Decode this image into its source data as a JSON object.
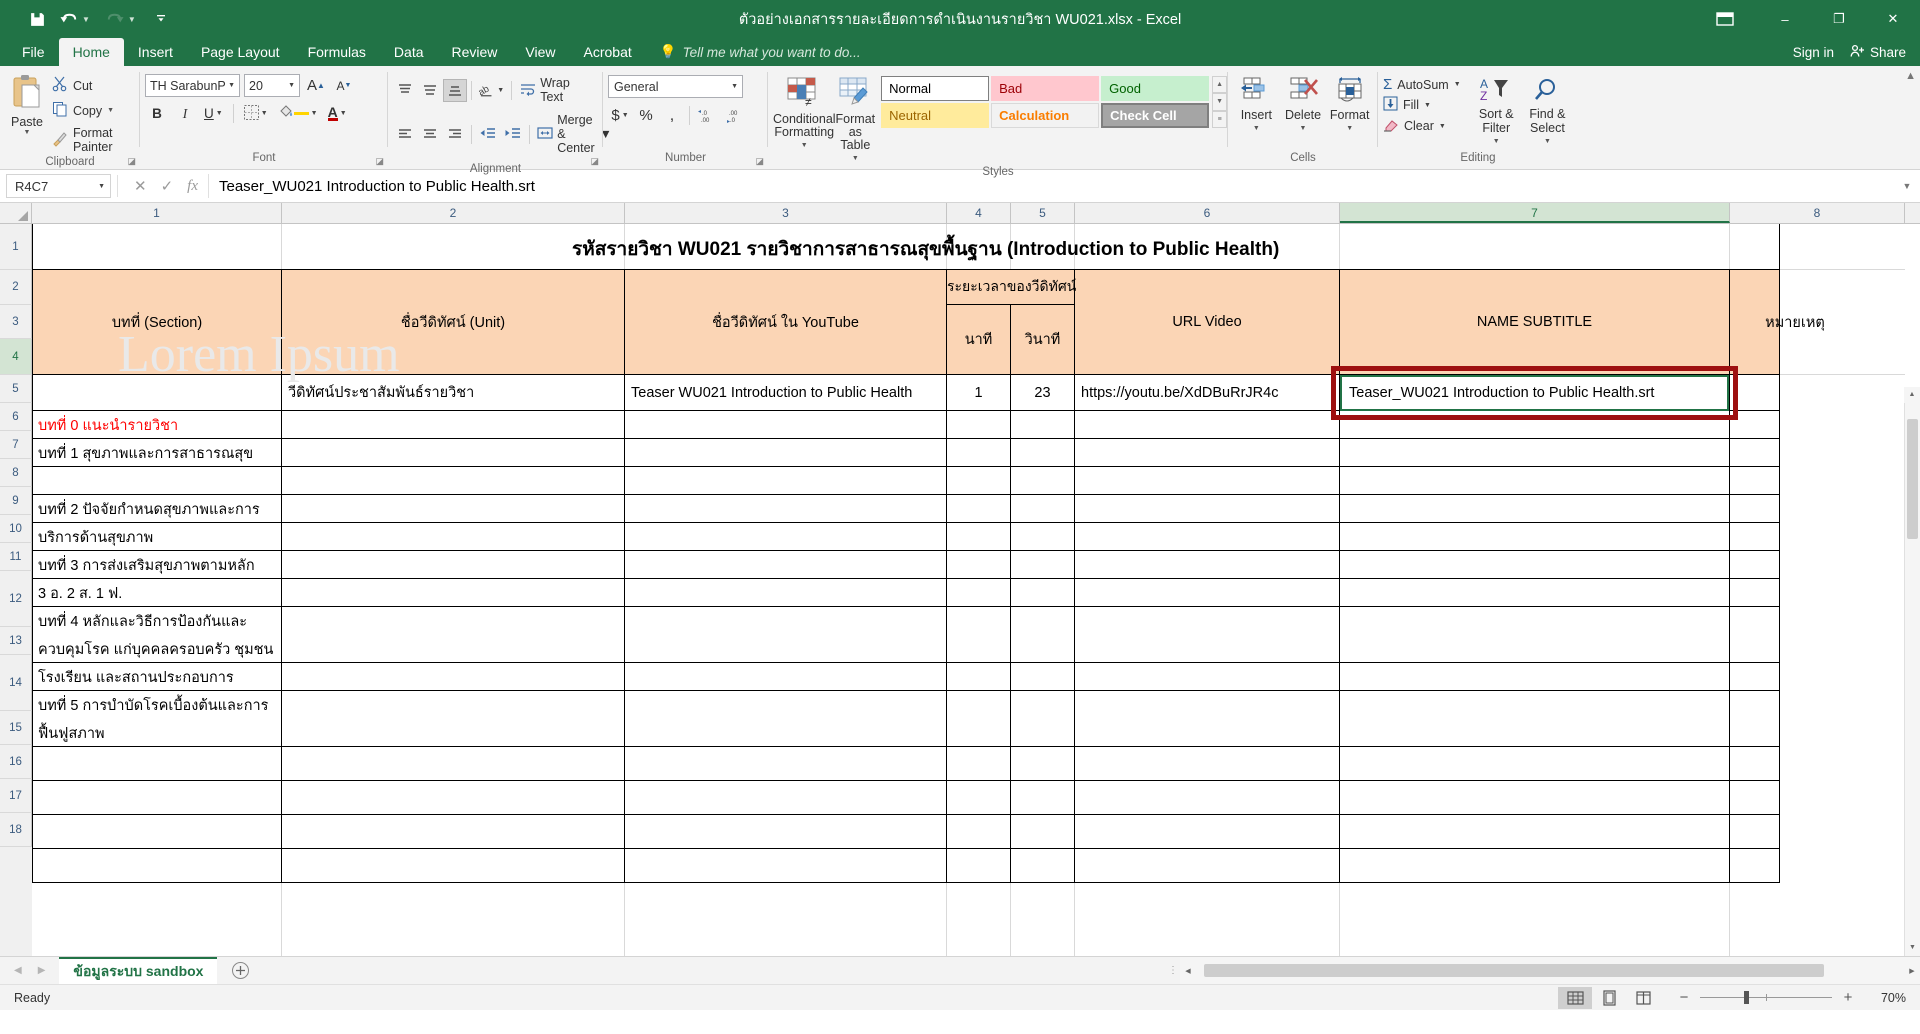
{
  "window": {
    "title": "ตัวอย่างเอกสารรายละเอียดการดำเนินงานรายวิชา WU021.xlsx - Excel",
    "minimize": "–",
    "maximize": "❐",
    "close": "✕",
    "ribbon_display_options": "ribbon-display-icon"
  },
  "quick_access": {
    "save": "save-icon",
    "undo": "undo-icon",
    "redo": "redo-icon",
    "customize": "customize-icon"
  },
  "tabs": [
    {
      "label": "File",
      "active": false
    },
    {
      "label": "Home",
      "active": true
    },
    {
      "label": "Insert",
      "active": false
    },
    {
      "label": "Page Layout",
      "active": false
    },
    {
      "label": "Formulas",
      "active": false
    },
    {
      "label": "Data",
      "active": false
    },
    {
      "label": "Review",
      "active": false
    },
    {
      "label": "View",
      "active": false
    },
    {
      "label": "Acrobat",
      "active": false
    }
  ],
  "tell_me": "Tell me what you want to do...",
  "account": {
    "sign_in": "Sign in",
    "share": "Share"
  },
  "ribbon": {
    "clipboard": {
      "label": "Clipboard",
      "paste": "Paste",
      "cut": "Cut",
      "copy": "Copy",
      "format_painter": "Format Painter"
    },
    "font": {
      "label": "Font",
      "font_name": "TH SarabunPSI",
      "font_size": "20",
      "grow_font": "A",
      "shrink_font": "A",
      "bold": "B",
      "italic": "I",
      "underline": "U",
      "borders": "borders-icon",
      "fill_color": "fill-color-icon",
      "font_color": "A"
    },
    "alignment": {
      "label": "Alignment",
      "top_align": "top-align-icon",
      "middle_align": "middle-align-icon",
      "bottom_align": "bottom-align-icon",
      "orientation": "orientation-icon",
      "wrap_text": "Wrap Text",
      "align_left": "align-left-icon",
      "align_center": "align-center-icon",
      "align_right": "align-right-icon",
      "decrease_indent": "decrease-indent-icon",
      "increase_indent": "increase-indent-icon",
      "merge_center": "Merge & Center"
    },
    "number": {
      "label": "Number",
      "format": "General",
      "accounting": "$",
      "percent": "%",
      "comma": ",",
      "increase_decimal": ".00",
      "decrease_decimal": ".00"
    },
    "styles": {
      "label": "Styles",
      "conditional_formatting": "Conditional Formatting",
      "format_as_table": "Format as Table",
      "gallery": [
        {
          "label": "Normal",
          "kind": "normal"
        },
        {
          "label": "Bad",
          "kind": "bad"
        },
        {
          "label": "Good",
          "kind": "good"
        },
        {
          "label": "Neutral",
          "kind": "neutral"
        },
        {
          "label": "Calculation",
          "kind": "calc"
        },
        {
          "label": "Check Cell",
          "kind": "check"
        }
      ]
    },
    "cells": {
      "label": "Cells",
      "insert": "Insert",
      "delete": "Delete",
      "format": "Format"
    },
    "editing": {
      "label": "Editing",
      "autosum": "AutoSum",
      "fill": "Fill",
      "clear": "Clear",
      "sort_filter": "Sort & Filter",
      "find_select": "Find & Select"
    }
  },
  "formula_bar": {
    "name_box": "R4C7",
    "cancel": "cancel-icon",
    "enter": "enter-icon",
    "insert_function": "fx",
    "value": "Teaser_WU021 Introduction to Public Health.srt",
    "expand": "expand-formula-bar-icon"
  },
  "watermark": "Lorem Ipsum",
  "sheet": {
    "column_headers": [
      "1",
      "2",
      "3",
      "4",
      "5",
      "6",
      "7",
      "8"
    ],
    "selected_column": "7",
    "row_headers": [
      "1",
      "2",
      "3",
      "4",
      "5",
      "6",
      "7",
      "8",
      "9",
      "10",
      "11",
      "12",
      "13",
      "14",
      "15",
      "16",
      "17",
      "18"
    ],
    "selected_row": "4",
    "title_cell": "รหัสรายวิชา WU021   รายวิชาการสาธารณสุขพื้นฐาน (Introduction to Public Health)",
    "headers": {
      "section": "บทที่ (Section)",
      "unit": "ชื่อวีดิทัศน์ (Unit)",
      "youtube": "ชื่อวีดิทัศน์ ใน YouTube",
      "duration": "ระยะเวลาของวีดิทัศน์",
      "minute": "นาที",
      "second": "วินาที",
      "url": "URL Video",
      "subtitle": "NAME SUBTITLE",
      "remark": "หมายเหตุ"
    },
    "data_row": {
      "unit": "วีดิทัศน์ประชาสัมพันธ์รายวิชา",
      "youtube": "Teaser WU021 Introduction to Public Health",
      "minute": "1",
      "second": "23",
      "url": "https://youtu.be/XdDBuRrJR4c",
      "subtitle": "Teaser_WU021 Introduction to Public Health.srt"
    },
    "sections": [
      {
        "row": "5",
        "text": "บทที่ 0 แนะนำรายวิชา",
        "color": "#ff0000"
      },
      {
        "row": "6",
        "text": "บทที่ 1 สุขภาพและการสาธารณสุข",
        "color": "#000000"
      },
      {
        "row": "8",
        "text": "บทที่ 2 ปัจจัยกำหนดสุขภาพและการ",
        "color": "#000000"
      },
      {
        "row": "9",
        "text": "บริการด้านสุขภาพ",
        "color": "#000000"
      },
      {
        "row": "10",
        "text": "บทที่ 3 การส่งเสริมสุขภาพตามหลัก",
        "color": "#000000"
      },
      {
        "row": "11",
        "text": " 3 อ. 2 ส. 1 ฟ.",
        "color": "#000000"
      },
      {
        "row": "12a",
        "text": "บทที่ 4 หลักและวิธีการป้องกันและ",
        "color": "#000000"
      },
      {
        "row": "12b",
        "text": "ควบคุมโรค แก่บุคคลครอบครัว ชุมชน",
        "color": "#000000"
      },
      {
        "row": "13",
        "text": "โรงเรียน และสถานประกอบการ",
        "color": "#000000"
      },
      {
        "row": "14a",
        "text": "บทที่ 5 การบำบัดโรคเบื้องต้นและการ",
        "color": "#000000"
      },
      {
        "row": "14b",
        "text": "ฟื้นฟูสภาพ",
        "color": "#000000"
      }
    ],
    "annotation_color": "#9e1010",
    "active_cell_color": "#217346",
    "header_fill": "#fbd5b5"
  },
  "sheet_tabs": {
    "prev": "prev-sheet-icon",
    "next": "next-sheet-icon",
    "sheets": [
      {
        "name": "ข้อมูลระบบ sandbox",
        "active": true
      }
    ],
    "add": "+"
  },
  "status_bar": {
    "state": "Ready",
    "view_normal": "normal-view-icon",
    "view_page_layout": "page-layout-view-icon",
    "view_page_break": "page-break-view-icon",
    "zoom_out": "−",
    "zoom_in": "+",
    "zoom_level": "70%"
  }
}
